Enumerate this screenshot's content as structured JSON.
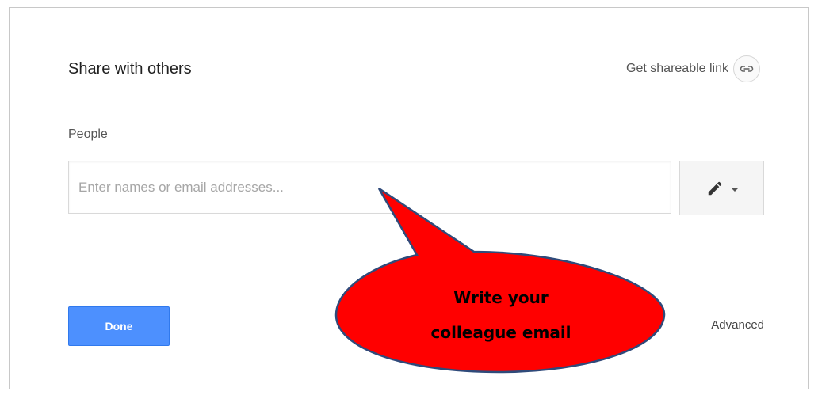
{
  "dialog": {
    "title": "Share with others",
    "shareable_link_label": "Get shareable link",
    "shareable_link_icon": "link-icon"
  },
  "people": {
    "label": "People",
    "input_value": "",
    "input_placeholder": "Enter names or email addresses...",
    "permission_icon": "pencil-icon",
    "permission_dropdown_icon": "caret-down-icon"
  },
  "footer": {
    "done_label": "Done",
    "advanced_label": "Advanced"
  },
  "annotation": {
    "line1": "Write your",
    "line2": "colleague email",
    "fill_color": "#ff0000",
    "outline_color": "#2f4a7a"
  },
  "colors": {
    "primary_button": "#4d90fe"
  }
}
